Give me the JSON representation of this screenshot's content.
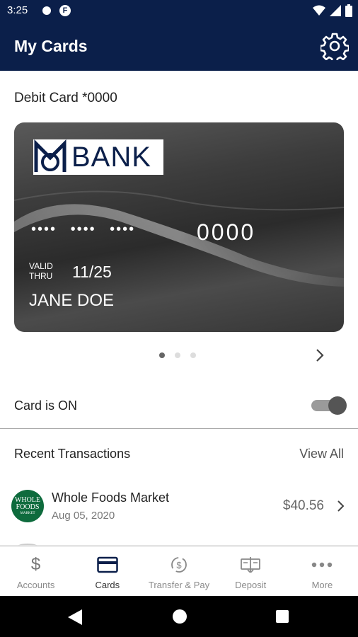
{
  "status_bar": {
    "time": "3:25",
    "icons": [
      "notification-dot-icon",
      "app-f-icon",
      "wifi-icon",
      "signal-icon",
      "battery-icon"
    ]
  },
  "header": {
    "title": "My Cards",
    "settings_icon": "gear-icon"
  },
  "card": {
    "heading": "Debit Card *0000",
    "bank_name": "BANK",
    "masked_number": "•••• •••• ••••",
    "last4": "0000",
    "valid_thru_line1": "VALID",
    "valid_thru_line2": "THRU",
    "expiry": "11/25",
    "holder": "JANE DOE"
  },
  "pager": {
    "count": 3,
    "active_index": 0
  },
  "card_toggle": {
    "label": "Card is ON",
    "on": true
  },
  "transactions": {
    "title": "Recent Transactions",
    "view_all": "View All",
    "items": [
      {
        "merchant": "Whole Foods Market",
        "date": "Aug 05, 2020",
        "amount": "$40.56",
        "logo_line1": "WHOLE",
        "logo_line2": "FOODS",
        "logo_line3": "MARKET"
      }
    ]
  },
  "bottom_nav": {
    "items": [
      {
        "label": "Accounts",
        "icon": "dollar-icon",
        "active": false
      },
      {
        "label": "Cards",
        "icon": "credit-card-icon",
        "active": true
      },
      {
        "label": "Transfer & Pay",
        "icon": "transfer-icon",
        "active": false
      },
      {
        "label": "Deposit",
        "icon": "check-deposit-icon",
        "active": false
      },
      {
        "label": "More",
        "icon": "more-dots-icon",
        "active": false
      }
    ]
  },
  "colors": {
    "header_bg": "#0b1f4a",
    "whole_foods_green": "#0e6b3d",
    "active_nav": "#0b1f4a"
  }
}
